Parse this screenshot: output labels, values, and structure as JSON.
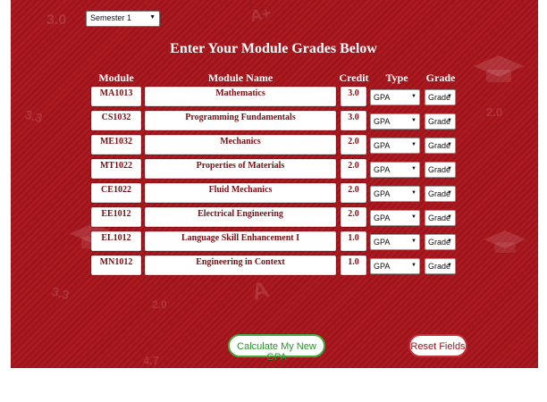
{
  "semester": {
    "selected": "Semester 1",
    "arrow": "▼"
  },
  "title": "Enter Your Module Grades Below",
  "columns": {
    "code": "Module Code",
    "name": "Module Name",
    "credit": "Credit",
    "type": "Type",
    "grade": "Grade"
  },
  "modules": [
    {
      "code": "MA1013",
      "name": "Mathematics",
      "credit": "3.0",
      "type": "GPA",
      "grade": "Grade"
    },
    {
      "code": "CS1032",
      "name": "Programming Fundamentals",
      "credit": "3.0",
      "type": "GPA",
      "grade": "Grade"
    },
    {
      "code": "ME1032",
      "name": "Mechanics",
      "credit": "2.0",
      "type": "GPA",
      "grade": "Grade"
    },
    {
      "code": "MT1022",
      "name": "Properties of Materials",
      "credit": "2.0",
      "type": "GPA",
      "grade": "Grade"
    },
    {
      "code": "CE1022",
      "name": "Fluid Mechanics",
      "credit": "2.0",
      "type": "GPA",
      "grade": "Grade"
    },
    {
      "code": "EE1012",
      "name": "Electrical Engineering",
      "credit": "2.0",
      "type": "GPA",
      "grade": "Grade"
    },
    {
      "code": "EL1012",
      "name": "Language Skill Enhancement I",
      "credit": "1.0",
      "type": "GPA",
      "grade": "Grade"
    },
    {
      "code": "MN1012",
      "name": "Engineering in Context",
      "credit": "1.0",
      "type": "GPA",
      "grade": "Grade"
    }
  ],
  "buttons": {
    "calculate": "Calculate My New GPA",
    "reset": "Reset Fields"
  },
  "background_marks": [
    "3.0",
    "3.3",
    "A+",
    "3.0",
    "3.3",
    "2.0",
    "A",
    "4.7",
    "2.0"
  ],
  "colors": {
    "panel": "#a8141c",
    "calc_border": "#3faa3f",
    "reset_border": "#c4303a",
    "cell_text": "#7a1015"
  }
}
